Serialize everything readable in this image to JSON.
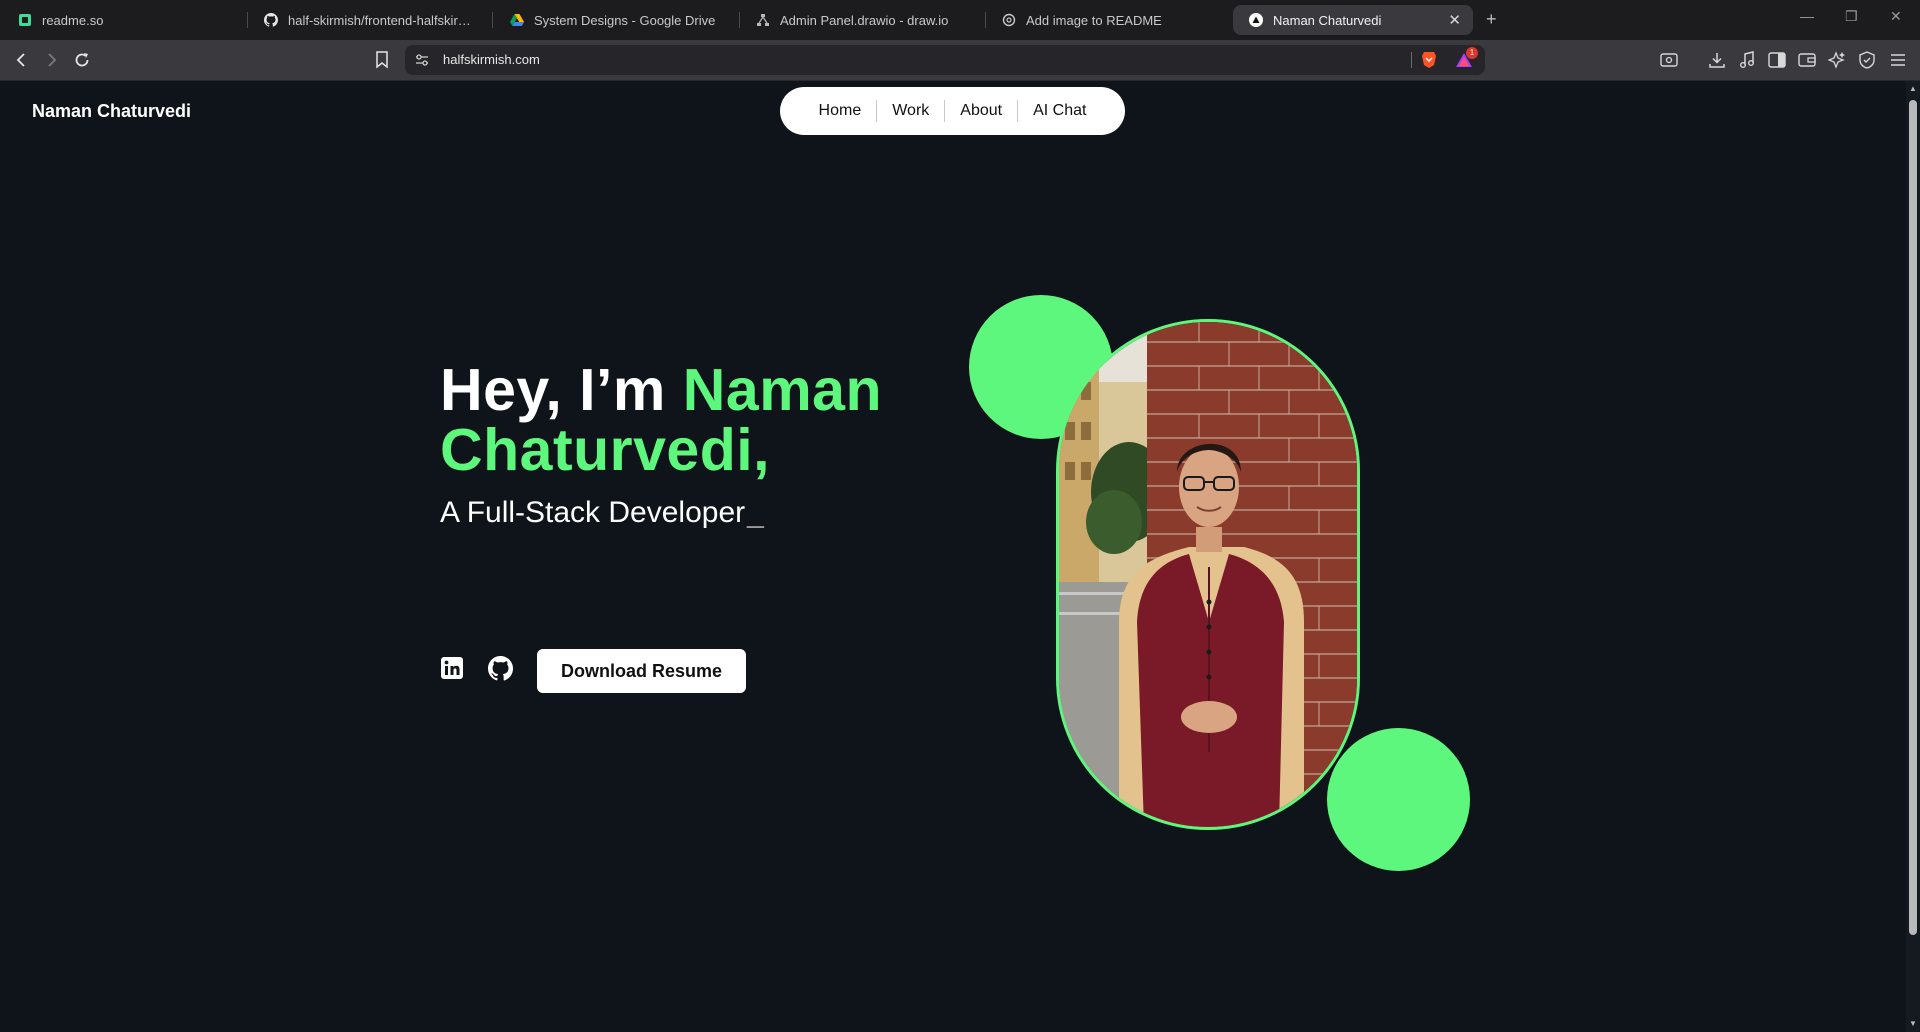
{
  "browser": {
    "tabs": [
      {
        "title": "readme.so",
        "icon": "readme-so-icon"
      },
      {
        "title": "half-skirmish/frontend-halfskirmish-v1",
        "icon": "github-icon"
      },
      {
        "title": "System Designs - Google Drive",
        "icon": "google-drive-icon"
      },
      {
        "title": "Admin Panel.drawio - draw.io",
        "icon": "drawio-icon"
      },
      {
        "title": "Add image to README",
        "icon": "chatgpt-icon"
      },
      {
        "title": "Naman Chaturvedi",
        "icon": "site-triangle-icon",
        "active": true
      }
    ],
    "url": "halfskirmish.com",
    "rewards_badge": "1"
  },
  "site": {
    "brand": "Naman Chaturvedi",
    "nav": [
      "Home",
      "Work",
      "About",
      "AI Chat"
    ],
    "hero": {
      "greeting": "Hey, I’m ",
      "name_part1": "Naman",
      "name_part2": "Chaturvedi,",
      "subtitle": "A Full-Stack Developer",
      "cursor": "_",
      "resume_button": "Download Resume"
    },
    "social": [
      "linkedin-icon",
      "github-icon"
    ],
    "accent_color": "#5ef77d",
    "background_color": "#0f131a"
  }
}
